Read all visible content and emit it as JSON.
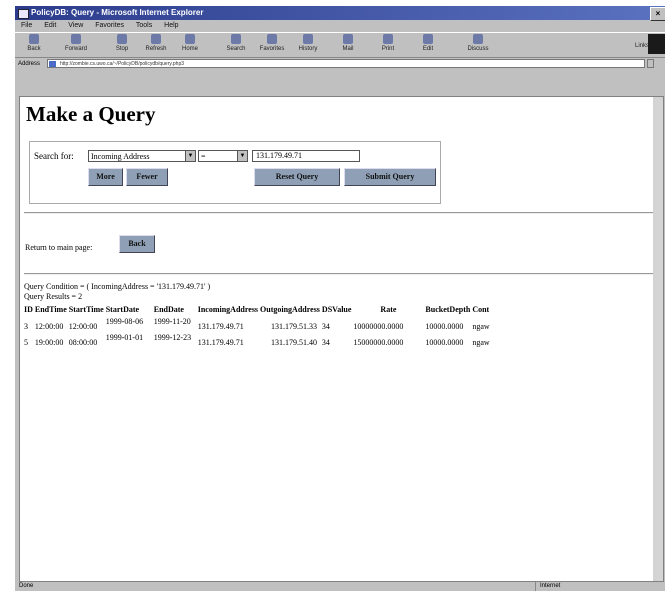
{
  "window": {
    "title": "PolicyDB: Query - Microsoft Internet Explorer",
    "menu": [
      "File",
      "Edit",
      "View",
      "Favorites",
      "Tools",
      "Help"
    ],
    "toolbar": [
      "Back",
      "Forward",
      "Stop",
      "Refresh",
      "Home",
      "Search",
      "Favorites",
      "History",
      "Mail",
      "Print",
      "Edit",
      "Discuss"
    ],
    "toolbar_end_label": "Links",
    "address_label": "Address",
    "address_url": "http://zombie.cs.uwo.ca/~/PolicyDB/policydb/query.php3",
    "status_left": "Done",
    "status_right": "Internet"
  },
  "page": {
    "heading": "Make a Query",
    "search_label": "Search for:",
    "field_select": "Incoming Address",
    "operator_select": "=",
    "search_value": "131.179.49.71",
    "more_button": "More",
    "fewer_button": "Fewer",
    "reset_button": "Reset Query",
    "submit_button": "Submit Query",
    "return_label": "Return to main page:",
    "back_button": "Back",
    "query_condition": "Query Condition = ( IncomingAddress = '131.179.49.71' )",
    "query_results": "Query Results = 2"
  },
  "table": {
    "headers": [
      "ID",
      "EndTime",
      "StartTime",
      "StartDate",
      "EndDate",
      "IncomingAddress",
      "OutgoingAddress",
      "DSValue",
      "Rate",
      "BucketDepth",
      "Cont"
    ],
    "rows": [
      [
        "3",
        "12:00:00",
        "12:00:00",
        "1999-08-06",
        "1999-11-20",
        "131.179.49.71",
        "131.179.51.33",
        "34",
        "10000000.0000",
        "10000.0000",
        "ngaw"
      ],
      [
        "5",
        "19:00:00",
        "08:00:00",
        "1999-01-01",
        "1999-12-23",
        "131.179.49.71",
        "131.179.51.40",
        "34",
        "15000000.0000",
        "10000.0000",
        "ngaw"
      ]
    ]
  }
}
